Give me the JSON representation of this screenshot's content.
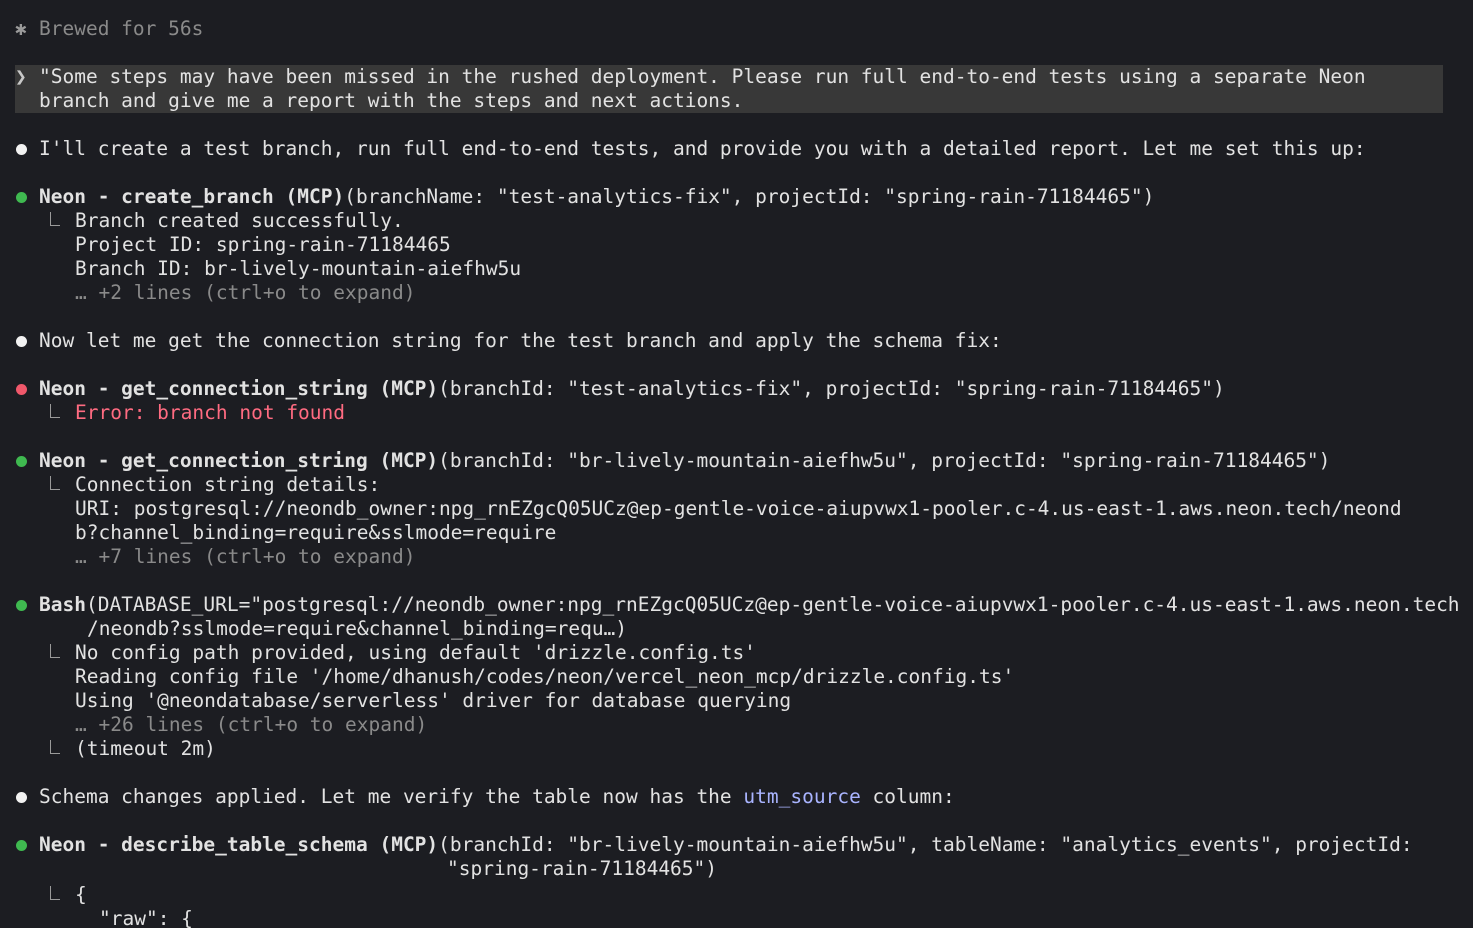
{
  "status": {
    "icon": "asterisk-icon",
    "text": "Brewed for 56s"
  },
  "prompt": {
    "icon": "chevron-right-icon",
    "line1": "\"Some steps may have been missed in the rushed deployment. Please run full end-to-end tests using a separate Neon",
    "line2": "branch and give me a report with the steps and next actions."
  },
  "messages": [
    {
      "type": "text",
      "bullet_color": "#f2f2f2",
      "text": "I'll create a test branch, run full end-to-end tests, and provide you with a detailed report. Let me set this up:"
    },
    {
      "type": "tool",
      "bullet_color": "#3fb950",
      "name": "Neon - create_branch (MCP)",
      "args": "(branchName: \"test-analytics-fix\", projectId: \"spring-rain-71184465\")",
      "output": [
        "Branch created successfully.",
        "Project ID: spring-rain-71184465",
        "Branch ID: br-lively-mountain-aiefhw5u"
      ],
      "more": "… +2 lines (ctrl+o to expand)"
    },
    {
      "type": "text",
      "bullet_color": "#f2f2f2",
      "text": "Now let me get the connection string for the test branch and apply the schema fix:"
    },
    {
      "type": "tool",
      "bullet_color": "#f0586b",
      "name": "Neon - get_connection_string (MCP)",
      "args": "(branchId: \"test-analytics-fix\", projectId: \"spring-rain-71184465\")",
      "error": "Error: branch not found"
    },
    {
      "type": "tool",
      "bullet_color": "#3fb950",
      "name": "Neon - get_connection_string (MCP)",
      "args": "(branchId: \"br-lively-mountain-aiefhw5u\", projectId: \"spring-rain-71184465\")",
      "output": [
        "Connection string details:",
        "URI: postgresql://neondb_owner:npg_rnEZgcQ05UCz@ep-gentle-voice-aiupvwx1-pooler.c-4.us-east-1.aws.neon.tech/neond",
        "b?channel_binding=require&sslmode=require"
      ],
      "more": "… +7 lines (ctrl+o to expand)"
    },
    {
      "type": "tool",
      "bullet_color": "#3fb950",
      "name": "Bash",
      "args": "(DATABASE_URL=\"postgresql://neondb_owner:npg_rnEZgcQ05UCz@ep-gentle-voice-aiupvwx1-pooler.c-4.us-east-1.aws.neon.tech",
      "args2": "/neondb?sslmode=require&channel_binding=requ…)",
      "output": [
        "No config path provided, using default 'drizzle.config.ts'",
        "Reading config file '/home/dhanush/codes/neon/vercel_neon_mcp/drizzle.config.ts'",
        "Using '@neondatabase/serverless' driver for database querying"
      ],
      "more": "… +26 lines (ctrl+o to expand)",
      "timeout": "(timeout 2m)"
    },
    {
      "type": "text",
      "bullet_color": "#f2f2f2",
      "text_before": "Schema changes applied. Let me verify the table now has the ",
      "code": "utm_source",
      "text_after": " column:"
    },
    {
      "type": "tool",
      "bullet_color": "#3fb950",
      "name": "Neon - describe_table_schema (MCP)",
      "args": "(branchId: \"br-lively-mountain-aiefhw5u\", tableName: \"analytics_events\", projectId:",
      "args2": "\"spring-rain-71184465\")",
      "output": [
        "{",
        "\"raw\": {"
      ]
    }
  ],
  "colors": {
    "background": "#1c1d22",
    "text": "#e2e2e2",
    "dim": "#8a8a8a",
    "error": "#ff6b81",
    "inline_code": "#a9b4ff",
    "prompt_bg": "#383838",
    "success_dot": "#3fb950",
    "error_dot": "#f0586b"
  }
}
